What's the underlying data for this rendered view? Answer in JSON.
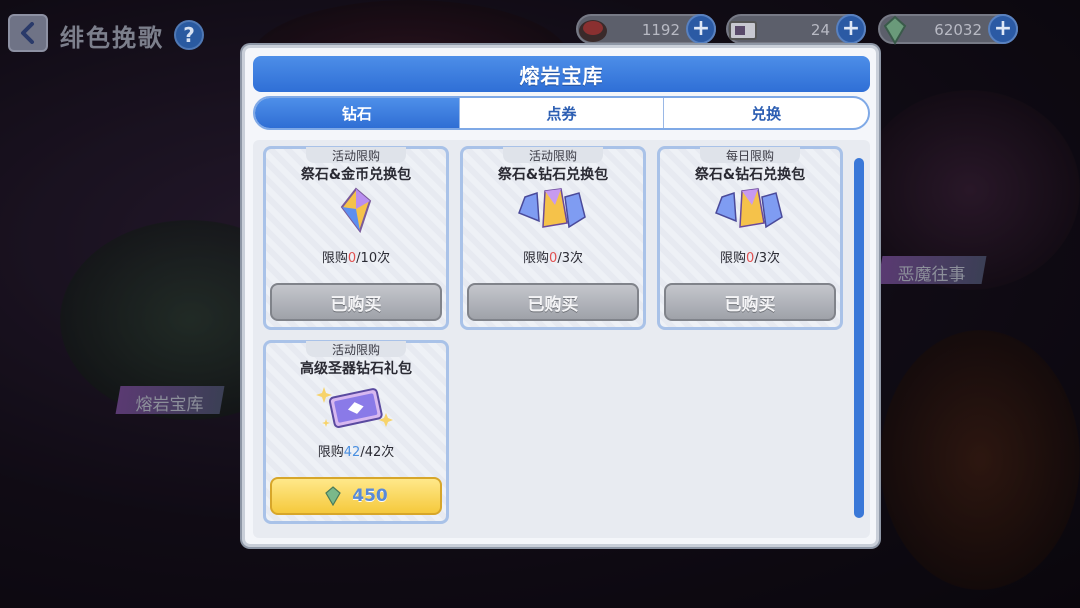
{
  "top_bar": {
    "title": "绯色挽歌",
    "help_glyph": "?",
    "currencies": [
      {
        "icon": "stone-currency-icon",
        "value": "1192"
      },
      {
        "icon": "ticket-currency-icon",
        "value": "24"
      },
      {
        "icon": "crystal-currency-icon",
        "value": "62032"
      }
    ],
    "plus_glyph": "+"
  },
  "background_labels": {
    "left": "熔岩宝库",
    "right": "恶魔往事"
  },
  "dialog": {
    "title": "熔岩宝库",
    "tabs": [
      {
        "label": "钻石",
        "active": true
      },
      {
        "label": "点券",
        "active": false
      },
      {
        "label": "兑换",
        "active": false
      }
    ],
    "items": [
      {
        "tag": "活动限购",
        "name": "祭石&金币兑换包",
        "icon": "single-crystal-icon",
        "quota_prefix": "限购",
        "used": "0",
        "quota_suffix": "/10次",
        "button": "已购买"
      },
      {
        "tag": "活动限购",
        "name": "祭石&钻石兑换包",
        "icon": "triple-crystal-icon",
        "quota_prefix": "限购",
        "used": "0",
        "quota_suffix": "/3次",
        "button": "已购买"
      },
      {
        "tag": "每日限购",
        "name": "祭石&钻石兑换包",
        "icon": "triple-crystal-icon",
        "quota_prefix": "限购",
        "used": "0",
        "quota_suffix": "/3次",
        "button": "已购买"
      },
      {
        "tag": "活动限购",
        "name": "高级圣器钻石礼包",
        "icon": "artifact-card-icon",
        "quota_prefix": "限购",
        "used": "42",
        "quota_suffix": "/42次",
        "button": "450"
      }
    ]
  },
  "colors": {
    "accent_blue": "#2f6fd6",
    "used_red": "#e05050",
    "price_gold": "#f5c93c"
  }
}
